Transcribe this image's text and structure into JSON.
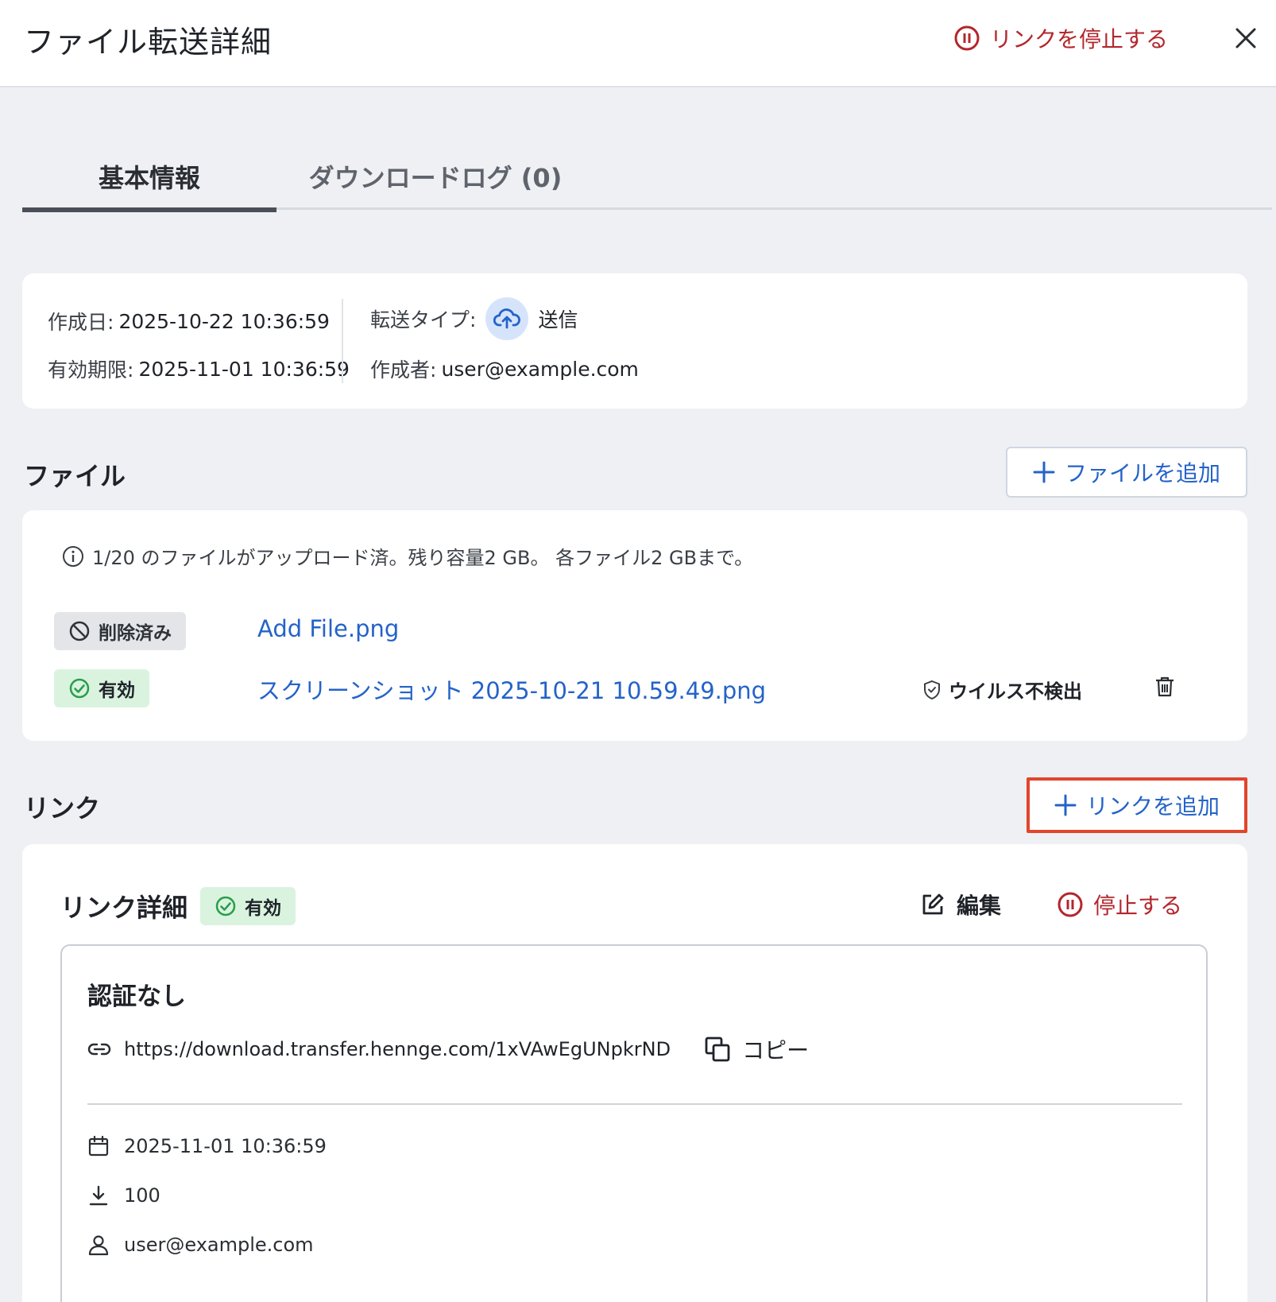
{
  "header": {
    "title": "ファイル転送詳細",
    "stop_link_label": "リンクを停止する"
  },
  "tabs": [
    {
      "label": "基本情報",
      "active": true
    },
    {
      "label": "ダウンロードログ (0)",
      "active": false
    }
  ],
  "info": {
    "created_label": "作成日:",
    "created_value": "2025-10-22 10:36:59",
    "expires_label": "有効期限:",
    "expires_value": "2025-11-01 10:36:59",
    "type_label": "転送タイプ:",
    "type_value": "送信",
    "creator_label": "作成者:",
    "creator_value": "user@example.com"
  },
  "files": {
    "section_title": "ファイル",
    "add_label": "ファイルを追加",
    "note": "1/20 のファイルがアップロード済。残り容量2 GB。 各ファイル2 GBまで。",
    "items": [
      {
        "status": "削除済み",
        "name": "Add File.png"
      },
      {
        "status": "有効",
        "name": "スクリーンショット 2025-10-21 10.59.49.png",
        "scan": "ウイルス不検出"
      }
    ]
  },
  "links": {
    "section_title": "リンク",
    "add_label": "リンクを追加",
    "detail_label": "リンク詳細",
    "status": "有効",
    "edit_label": "編集",
    "stop_label": "停止する",
    "auth": "認証なし",
    "url": "https://download.transfer.hennge.com/1xVAwEgUNpkrND",
    "copy_label": "コピー",
    "expiry": "2025-11-01 10:36:59",
    "download_limit": "100",
    "owner": "user@example.com"
  },
  "colors": {
    "accent_blue": "#2463c9",
    "danger_red": "#b3272d",
    "highlight_orange": "#e2452b",
    "valid_green_bg": "#d9f3df"
  }
}
